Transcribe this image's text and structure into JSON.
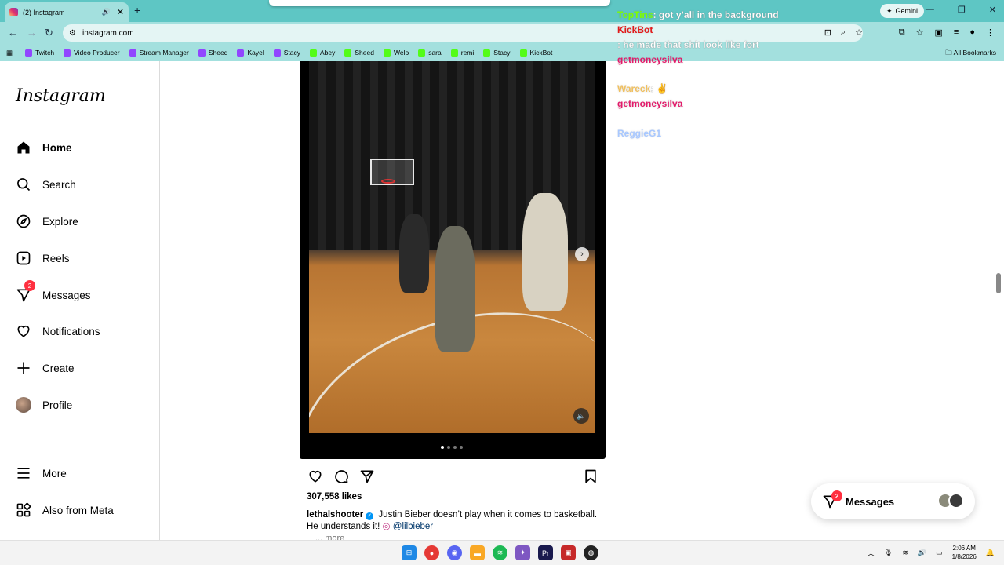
{
  "browser": {
    "tab_title": "(2) Instagram",
    "new_tab": "+",
    "url": "instagram.com",
    "gemini_label": "Gemini",
    "all_bookmarks": "All Bookmarks",
    "bookmarks": [
      {
        "label": "Twitch",
        "color": "#9146ff"
      },
      {
        "label": "Video Producer",
        "color": "#9146ff"
      },
      {
        "label": "Stream Manager",
        "color": "#9146ff"
      },
      {
        "label": "Sheed",
        "color": "#9146ff"
      },
      {
        "label": "Kayel",
        "color": "#9146ff"
      },
      {
        "label": "Stacy",
        "color": "#9146ff"
      },
      {
        "label": "Abey",
        "color": "#53fc18"
      },
      {
        "label": "Sheed",
        "color": "#53fc18"
      },
      {
        "label": "Welo",
        "color": "#53fc18"
      },
      {
        "label": "sara",
        "color": "#53fc18"
      },
      {
        "label": "remi",
        "color": "#53fc18"
      },
      {
        "label": "Stacy",
        "color": "#53fc18"
      },
      {
        "label": "KickBot",
        "color": "#53fc18"
      }
    ]
  },
  "sidebar": {
    "logo": "Instagram",
    "items": [
      {
        "label": "Home",
        "icon": "home-icon"
      },
      {
        "label": "Search",
        "icon": "search-icon"
      },
      {
        "label": "Explore",
        "icon": "compass-icon"
      },
      {
        "label": "Reels",
        "icon": "reels-icon"
      },
      {
        "label": "Messages",
        "icon": "messenger-icon",
        "badge": "2"
      },
      {
        "label": "Notifications",
        "icon": "heart-icon"
      },
      {
        "label": "Create",
        "icon": "plus-icon"
      },
      {
        "label": "Profile",
        "icon": "avatar"
      }
    ],
    "more": "More",
    "also_from_meta": "Also from Meta"
  },
  "post": {
    "likes": "307,558 likes",
    "username": "lethalshooter",
    "caption": "Justin Bieber doesn’t play when it comes to basketball. He understands it!",
    "mention": "@lilbieber",
    "more": "... more",
    "carousel_dots": 4,
    "active_dot": 0
  },
  "chat": [
    {
      "user": "TopTins",
      "color": "#7fff00",
      "text": ": got y’all in the background"
    },
    {
      "user": "KickBot",
      "color": "#e31a1a",
      "text": ""
    },
    {
      "user": "",
      "color": "#c9b0ff",
      "text": ": he made that shit look like fort"
    },
    {
      "user": "getmoneysilva",
      "color": "#e31a6a",
      "text": ""
    },
    {
      "user": "Wareck",
      "color": "#f0c060",
      "text": ": ✌"
    },
    {
      "user": "getmoneysilva",
      "color": "#e31a6a",
      "text": ""
    },
    {
      "user": "ReggieG1",
      "color": "#a8c8ff",
      "text": ""
    }
  ],
  "messages_pill": {
    "label": "Messages",
    "badge": "2"
  },
  "taskbar": {
    "time": "2:06 AM",
    "date": "1/8/2026"
  }
}
